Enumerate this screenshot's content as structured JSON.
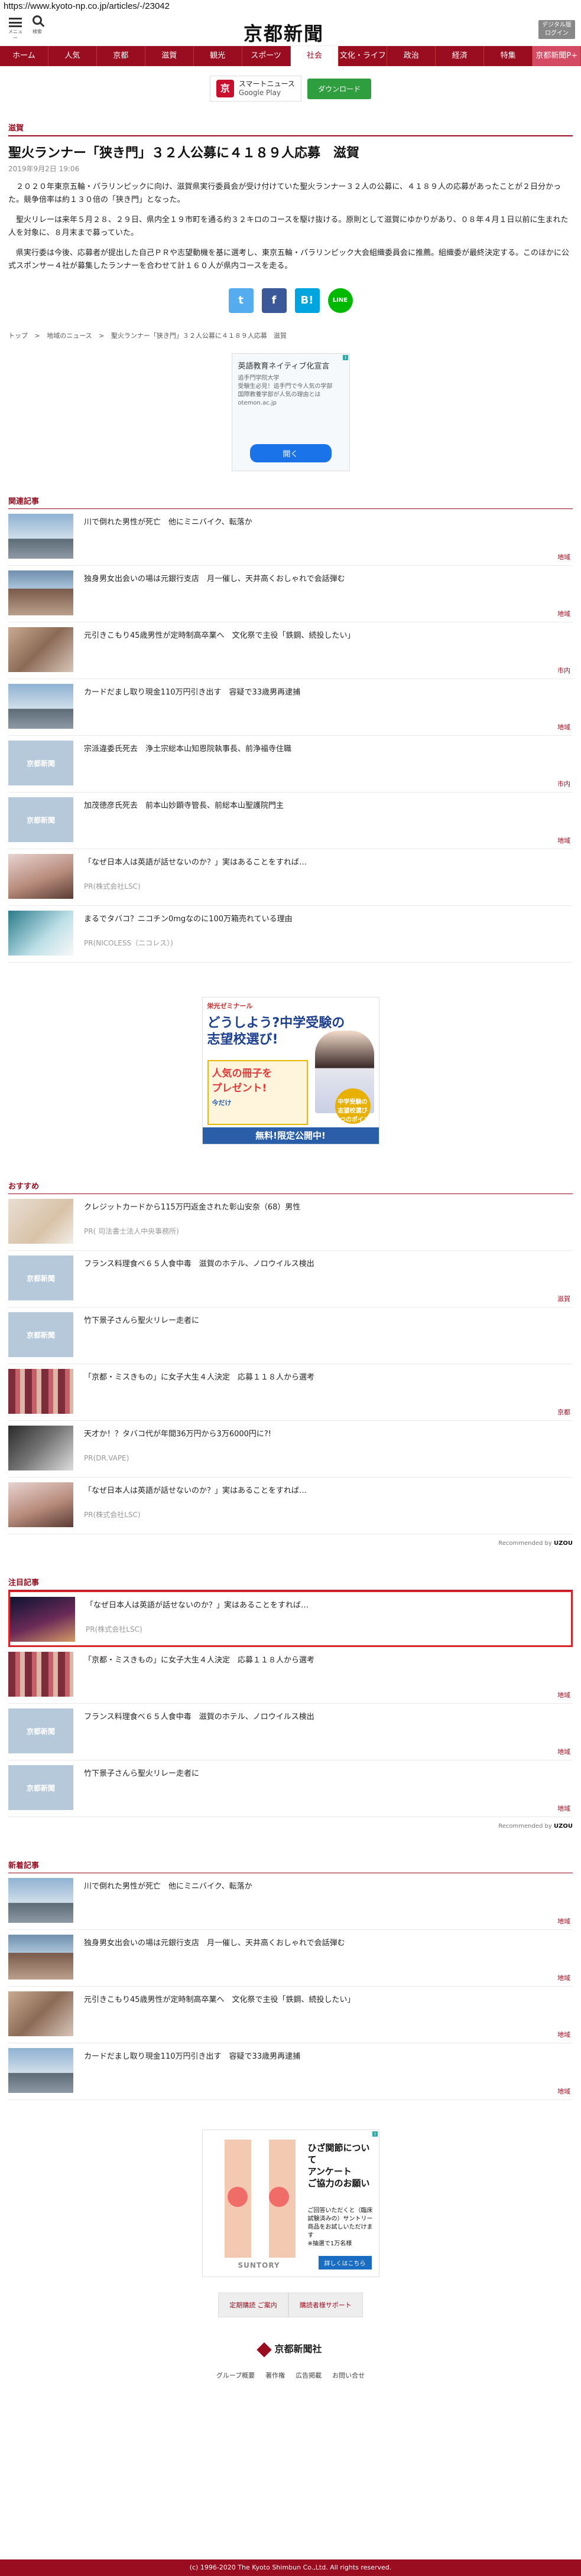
{
  "url": "https://www.kyoto-np.co.jp/articles/-/23042",
  "header": {
    "menu_label": "メニュー",
    "search_label": "検索",
    "logo": "京都新聞",
    "digital_button": "デジタル版 ログイン"
  },
  "nav": [
    "ホーム",
    "人気",
    "京都",
    "滋賀",
    "観光",
    "スポーツ",
    "社会",
    "文化・ライフ",
    "政治",
    "経済",
    "特集",
    "京都新聞P+"
  ],
  "app_banner": {
    "name": "京都新聞",
    "line1": "スマートニュース",
    "line2": "Google Play",
    "button": "ダウンロード"
  },
  "article": {
    "category": "滋賀",
    "title": "聖火ランナー「狭き門」３２人公募に４１８９人応募　滋賀",
    "date": "2019年9月2日 19:06",
    "paragraphs": [
      "２０２０年東京五輪・パラリンピックに向け、滋賀県実行委員会が受け付けていた聖火ランナー３２人の公募に、４１８９人の応募があったことが２日分かった。競争倍率は約１３０倍の「狭き門」となった。",
      "聖火リレーは来年５月２８、２９日、県内全１９市町を通る約３２キロのコースを駆け抜ける。原則として滋賀にゆかりがあり、０８年４月１日以前に生まれた人を対象に、８月末まで募っていた。",
      "県実行委は今後、応募者が提出した自己ＰＲや志望動機を基に選考し、東京五輪・パラリンピック大会組織委員会に推薦。組織委が最終決定する。このほかに公式スポンサー４社が募集したランナーを合わせて計１６０人が県内コースを走る。"
    ]
  },
  "share": {
    "twitter": "t",
    "facebook": "f",
    "hatena": "B!",
    "line": "LINE"
  },
  "breadcrumb": [
    "トップ",
    ">",
    "地域のニュース",
    ">",
    "聖火ランナー「狭き門」３２人公募に４１８９人応募　滋賀"
  ],
  "ad1": {
    "title": "英語教育ネイティブ化宣言",
    "line1": "追手門学院大学",
    "line2": "受験生必見！追手門で今人気の学部",
    "line3": "国際教養学部が人気の理由とは",
    "line4": "otemon.ac.jp",
    "button": "開く"
  },
  "related": {
    "label": "関連記事",
    "items": [
      {
        "title": "川で倒れた男性が死亡　他にミニバイク、転落か",
        "tag": "地域",
        "thumb": "building"
      },
      {
        "title": "独身男女出会いの場は元銀行支店　月一催し、天井高くおしゃれで会話弾む",
        "tag": "地域",
        "thumb": "building2"
      },
      {
        "title": "元引きこもり45歳男性が定時制高卒業へ　文化祭で主役「鉄鋼、続投したい」",
        "tag": "市内",
        "thumb": "people"
      },
      {
        "title": "カードだまし取り現金110万円引き出す　容疑で33歳男再逮捕",
        "tag": "地域",
        "thumb": "building"
      },
      {
        "title": "宗派違委氏死去　浄土宗総本山知恩院執事長、前浄福寺住職",
        "tag": "市内",
        "thumb": "placeholder"
      },
      {
        "title": "加茂徳彦氏死去　前本山妙顕寺管長、前総本山聖護院門主",
        "tag": "地域",
        "thumb": "placeholder"
      },
      {
        "title": "「なぜ日本人は英語が話せないのか？」実はあることをすれば…",
        "pr": "PR(株式会社LSC)",
        "thumb": "woman"
      },
      {
        "title": "まるでタバコ？ニコチン0mgなのに100万箱売れている理由",
        "pr": "PR(NICOLESS（ニコレス）)",
        "thumb": "smoke"
      }
    ]
  },
  "ad2": {
    "brand": "栄光ゼミナール",
    "q1": "どうしよう?中学受験の",
    "q2": "志望校選び!",
    "b1": "人気の冊子を",
    "b2": "プレゼント!",
    "tag": "今だけ",
    "bottom": "無料!限定公開中!",
    "badge": "中学受験の 志望校選び 5つのポイント"
  },
  "recommend": {
    "label": "おすすめ",
    "items": [
      {
        "title": "クレジットカードから115万円返金された彰山安奈（68）男性",
        "pr": "PR( 司法書士法人中央事務所)",
        "thumb": "money"
      },
      {
        "title": "フランス料理食べ６５人食中毒　滋賀のホテル、ノロウイルス検出",
        "tag": "滋賀",
        "thumb": "placeholder"
      },
      {
        "title": "竹下景子さんら聖火リレー走者に",
        "tag": "",
        "thumb": "placeholder"
      },
      {
        "title": "「京都・ミスきもの」に女子大生４人決定　応募１１８人から選考",
        "tag": "京都",
        "thumb": "kyoto"
      },
      {
        "title": "天才か！？タバコ代が年間36万円から3万6000円に?!",
        "pr": "PR(DR.VAPE)",
        "thumb": "smoke2"
      },
      {
        "title": "「なぜ日本人は英語が話せないのか？」実はあることをすれば…",
        "pr": "PR(株式会社LSC)",
        "thumb": "woman"
      }
    ],
    "powered_by": "Recommended by",
    "powered_brand": "UZOU"
  },
  "featured": {
    "label": "注目記事",
    "items": [
      {
        "title": "「なぜ日本人は英語が話せないのか？」実はあることをすれば…",
        "pr": "PR(株式会社LSC)",
        "thumb": "night"
      },
      {
        "title": "「京都・ミスきもの」に女子大生４人決定　応募１１８人から選考",
        "tag": "地域",
        "thumb": "kyoto"
      },
      {
        "title": "フランス料理食べ６５人食中毒　滋賀のホテル、ノロウイルス検出",
        "tag": "地域",
        "thumb": "placeholder"
      },
      {
        "title": "竹下景子さんら聖火リレー走者に",
        "tag": "地域",
        "thumb": "placeholder"
      }
    ],
    "powered_by": "Recommended by",
    "powered_brand": "UZOU"
  },
  "latest": {
    "label": "新着記事",
    "items": [
      {
        "title": "川で倒れた男性が死亡　他にミニバイク、転落か",
        "tag": "地域",
        "thumb": "building"
      },
      {
        "title": "独身男女出会いの場は元銀行支店　月一催し、天井高くおしゃれで会話弾む",
        "tag": "地域",
        "thumb": "building2"
      },
      {
        "title": "元引きこもり45歳男性が定時制高卒業へ　文化祭で主役「鉄鋼、続投したい」",
        "tag": "地域",
        "thumb": "people"
      },
      {
        "title": "カードだまし取り現金110万円引き出す　容疑で33歳男再逮捕",
        "tag": "地域",
        "thumb": "building"
      }
    ]
  },
  "ad3": {
    "l1": "ひざ関節について",
    "l2": "アンケート",
    "l3": "ご協力のお願い",
    "l4": "ご回答いただくと（臨床試験済みの）サントリー商品をお試しいただけます",
    "l5": "※抽選で1万名様",
    "btn": "詳しくはこちら",
    "brand": "SUNTORY"
  },
  "footer": {
    "btn1": "定期購読 ご案内",
    "btn2": "購読者様サポート",
    "logo": "京都新聞社",
    "links": [
      "グループ概要",
      "著作権",
      "広告掲載",
      "お問い合せ"
    ],
    "copyright": "(c) 1996-2020 The Kyoto Shimbun Co.,Ltd. All rights reserved."
  }
}
